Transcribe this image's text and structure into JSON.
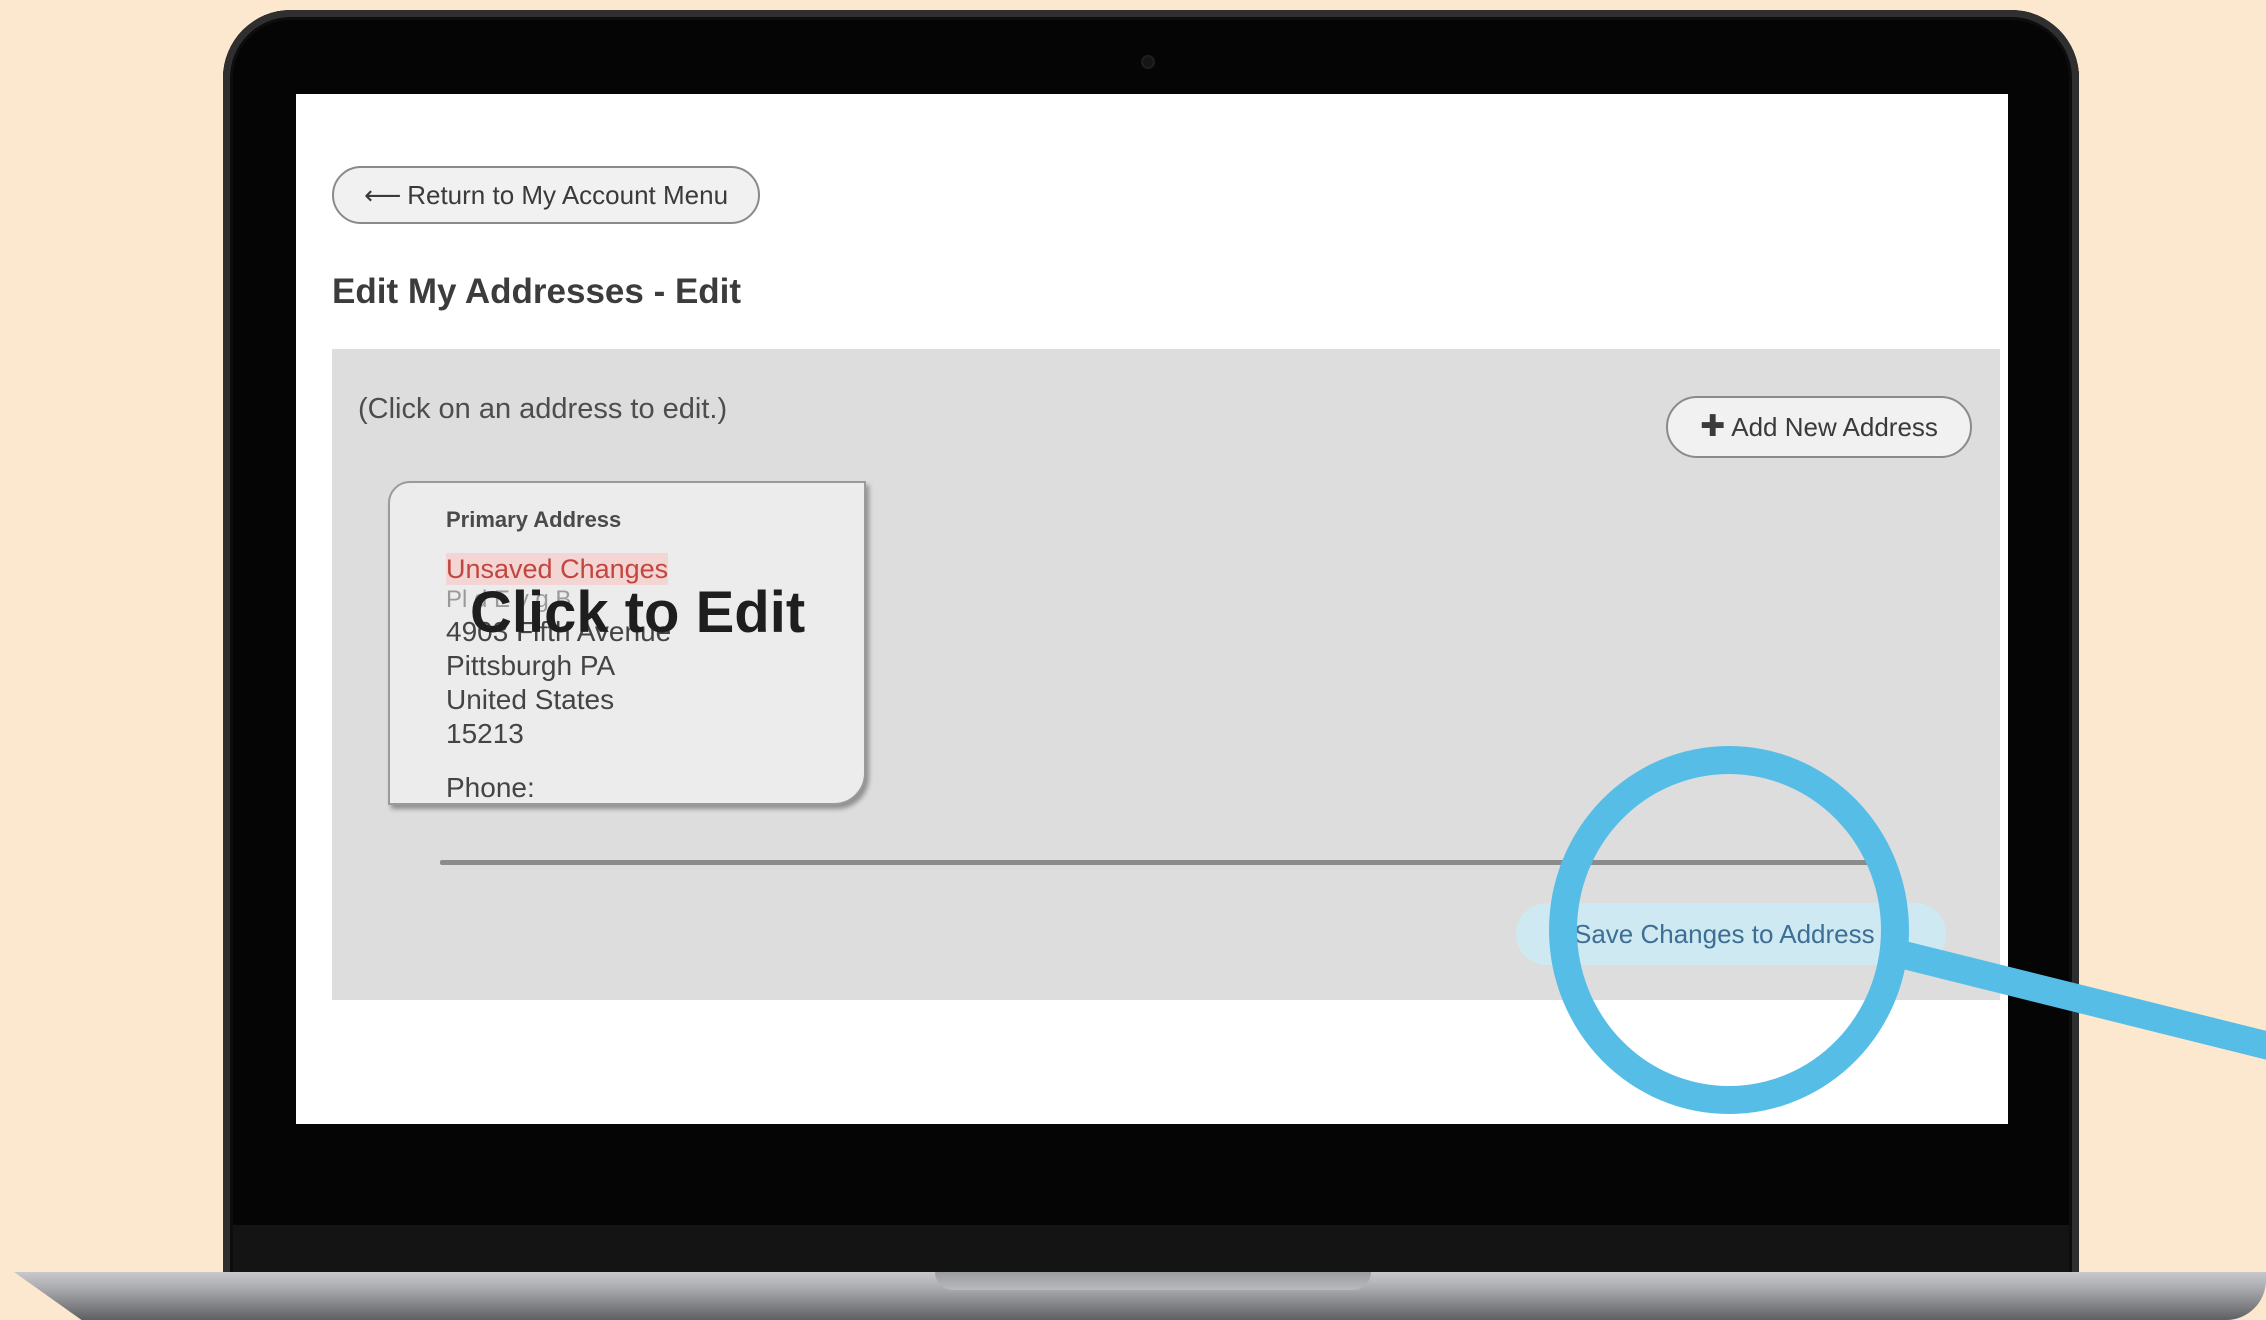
{
  "return_button": {
    "icon": "arrow-left-icon",
    "label": "Return to My Account Menu"
  },
  "page_title": "Edit My Addresses - Edit",
  "panel": {
    "hint": "(Click on an address to edit.)",
    "add_button": {
      "icon": "plus-icon",
      "label": "Add New Address"
    },
    "address_card": {
      "heading": "Primary Address",
      "status": "Unsaved Changes",
      "name_line": "Pl  d E  y  g B",
      "street": "4903 Fifth Avenue",
      "city_state": "Pittsburgh PA",
      "country": "United States",
      "zip": "15213",
      "phone_label": "Phone:",
      "overlay": "Click to Edit"
    },
    "save_button": {
      "label": "Save Changes to Address"
    }
  },
  "colors": {
    "background": "#fce8cf",
    "panel": "#dddddd",
    "unsaved_text": "#c2453f",
    "save_button_bg": "#cfe9f3",
    "save_button_text": "#3d6e94",
    "highlight_ring": "#56bde7"
  }
}
